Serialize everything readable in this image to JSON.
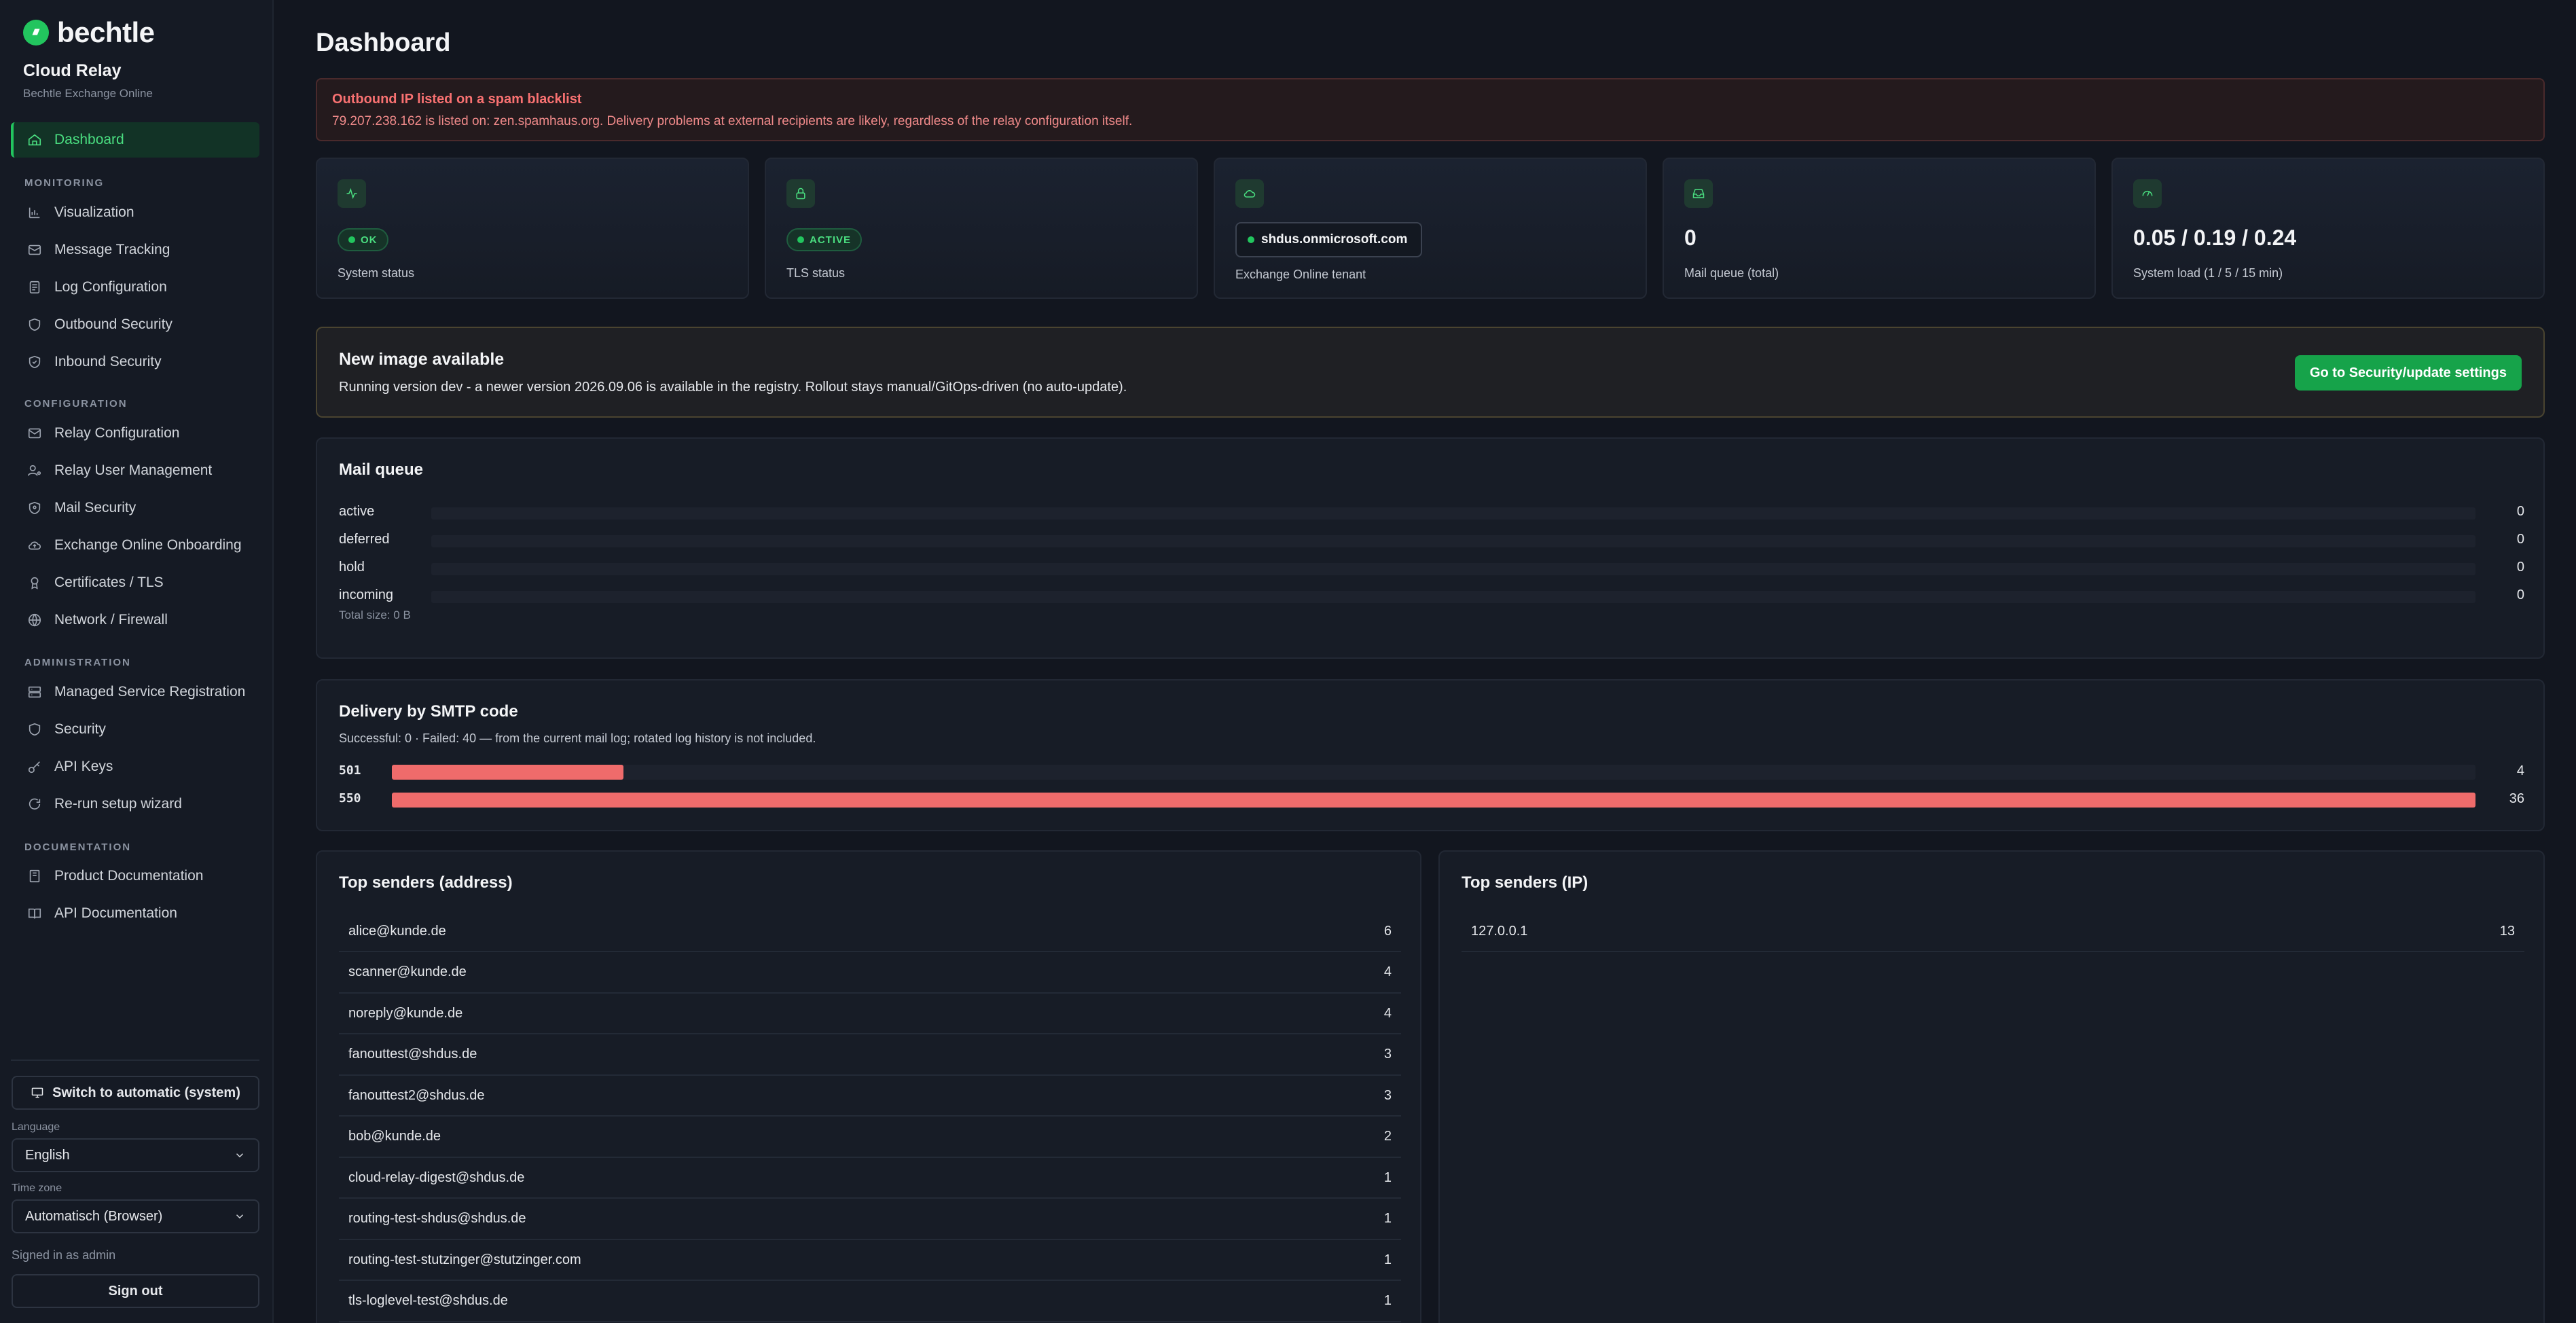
{
  "brand": {
    "name": "bechtle",
    "accent": "#22c55e"
  },
  "app": {
    "title": "Cloud Relay",
    "subtitle": "Bechtle Exchange Online"
  },
  "nav": {
    "dashboard": "Dashboard",
    "sections": {
      "monitoring": "MONITORING",
      "configuration": "CONFIGURATION",
      "administration": "ADMINISTRATION",
      "documentation": "DOCUMENTATION"
    },
    "monitoring": [
      "Visualization",
      "Message Tracking",
      "Log Configuration",
      "Outbound Security",
      "Inbound Security"
    ],
    "configuration": [
      "Relay Configuration",
      "Relay User Management",
      "Mail Security",
      "Exchange Online Onboarding",
      "Certificates / TLS",
      "Network / Firewall"
    ],
    "administration": [
      "Managed Service Registration",
      "Security",
      "API Keys",
      "Re-run setup wizard"
    ],
    "documentation": [
      "Product Documentation",
      "API Documentation"
    ]
  },
  "sidebar_footer": {
    "switch_label": "Switch to automatic (system)",
    "language_label": "Language",
    "language_value": "English",
    "timezone_label": "Time zone",
    "timezone_value": "Automatisch (Browser)",
    "signed_in": "Signed in as admin",
    "sign_out": "Sign out"
  },
  "page": {
    "title": "Dashboard"
  },
  "alert": {
    "title": "Outbound IP listed on a spam blacklist",
    "text": "79.207.238.162 is listed on: zen.spamhaus.org. Delivery problems at external recipients are likely, regardless of the relay configuration itself."
  },
  "stats": {
    "system": {
      "badge": "OK",
      "label": "System status"
    },
    "tls": {
      "badge": "ACTIVE",
      "label": "TLS status"
    },
    "tenant": {
      "value": "shdus.onmicrosoft.com",
      "label": "Exchange Online tenant"
    },
    "queue": {
      "value": "0",
      "label": "Mail queue (total)"
    },
    "load": {
      "value": "0.05 / 0.19 / 0.24",
      "label": "System load (1 / 5 / 15 min)"
    }
  },
  "update": {
    "title": "New image available",
    "text": "Running version dev - a newer version 2026.09.06 is available in the registry. Rollout stays manual/GitOps-driven (no auto-update).",
    "button": "Go to Security/update settings"
  },
  "mail_queue": {
    "title": "Mail queue",
    "rows": [
      {
        "label": "active",
        "value": 0
      },
      {
        "label": "deferred",
        "value": 0
      },
      {
        "label": "hold",
        "value": 0
      },
      {
        "label": "incoming",
        "value": 0
      }
    ],
    "total": "Total size: 0 B"
  },
  "smtp": {
    "title": "Delivery by SMTP code",
    "subtitle": "Successful: 0 · Failed: 40 — from the current mail log; rotated log history is not included.",
    "rows": [
      {
        "code": "501",
        "value": 4
      },
      {
        "code": "550",
        "value": 36
      }
    ],
    "max": 36
  },
  "top_address": {
    "title": "Top senders (address)",
    "rows": [
      {
        "address": "alice@kunde.de",
        "count": 6
      },
      {
        "address": "scanner@kunde.de",
        "count": 4
      },
      {
        "address": "noreply@kunde.de",
        "count": 4
      },
      {
        "address": "fanouttest@shdus.de",
        "count": 3
      },
      {
        "address": "fanouttest2@shdus.de",
        "count": 3
      },
      {
        "address": "bob@kunde.de",
        "count": 2
      },
      {
        "address": "cloud-relay-digest@shdus.de",
        "count": 1
      },
      {
        "address": "routing-test-shdus@shdus.de",
        "count": 1
      },
      {
        "address": "routing-test-stutzinger@stutzinger.com",
        "count": 1
      },
      {
        "address": "tls-loglevel-test@shdus.de",
        "count": 1
      }
    ]
  },
  "top_ip": {
    "title": "Top senders (IP)",
    "rows": [
      {
        "address": "127.0.0.1",
        "count": 13
      }
    ]
  }
}
